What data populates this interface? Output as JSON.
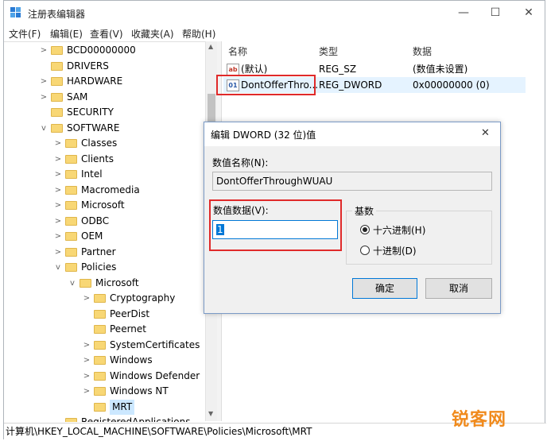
{
  "window": {
    "title": "注册表编辑器",
    "icon": "registry-icon",
    "controls": {
      "minimize": "—",
      "maximize": "☐",
      "close": "✕"
    }
  },
  "menu": [
    "文件(F)",
    "编辑(E)",
    "查看(V)",
    "收藏夹(A)",
    "帮助(H)"
  ],
  "tree": [
    {
      "label": "BCD00000000",
      "expander": ">"
    },
    {
      "label": "DRIVERS",
      "expander": ""
    },
    {
      "label": "HARDWARE",
      "expander": ">"
    },
    {
      "label": "SAM",
      "expander": ">"
    },
    {
      "label": "SECURITY",
      "expander": ""
    },
    {
      "label": "SOFTWARE",
      "expander": "v"
    },
    {
      "label": "Classes",
      "expander": ">"
    },
    {
      "label": "Clients",
      "expander": ">"
    },
    {
      "label": "Intel",
      "expander": ">"
    },
    {
      "label": "Macromedia",
      "expander": ">"
    },
    {
      "label": "Microsoft",
      "expander": ">"
    },
    {
      "label": "ODBC",
      "expander": ">"
    },
    {
      "label": "OEM",
      "expander": ">"
    },
    {
      "label": "Partner",
      "expander": ">"
    },
    {
      "label": "Policies",
      "expander": "v"
    },
    {
      "label": "Microsoft",
      "expander": "v"
    },
    {
      "label": "Cryptography",
      "expander": ">"
    },
    {
      "label": "PeerDist",
      "expander": ""
    },
    {
      "label": "Peernet",
      "expander": ""
    },
    {
      "label": "SystemCertificates",
      "expander": ">"
    },
    {
      "label": "Windows",
      "expander": ">"
    },
    {
      "label": "Windows Defender",
      "expander": ">"
    },
    {
      "label": "Windows NT",
      "expander": ">"
    },
    {
      "label": "MRT",
      "expander": "",
      "selected": true
    },
    {
      "label": "RegisteredApplications",
      "expander": ""
    }
  ],
  "list": {
    "headers": [
      "名称",
      "类型",
      "数据"
    ],
    "rows": [
      {
        "icon": "string-value-icon",
        "icon_text": "ab",
        "name": "(默认)",
        "type": "REG_SZ",
        "data": "(数值未设置)"
      },
      {
        "icon": "binary-value-icon",
        "icon_text": "01",
        "name": "DontOfferThro...",
        "type": "REG_DWORD",
        "data": "0x00000000 (0)",
        "selected": true
      }
    ]
  },
  "status": "计算机\\HKEY_LOCAL_MACHINE\\SOFTWARE\\Policies\\Microsoft\\MRT",
  "dialog": {
    "title": "编辑 DWORD (32 位)值",
    "close": "✕",
    "name_label": "数值名称(N):",
    "name_value": "DontOfferThroughWUAU",
    "data_label": "数值数据(V):",
    "data_value": "1",
    "base_label": "基数",
    "base_options": [
      {
        "label": "十六进制(H)",
        "checked": true
      },
      {
        "label": "十进制(D)",
        "checked": false
      }
    ],
    "ok": "确定",
    "cancel": "取消"
  },
  "watermark": "锐客网",
  "colors": {
    "highlight": "#e5f3ff",
    "selected_tree": "#cce8ff",
    "annotation": "#e02a2a",
    "watermark": "#f08a1c",
    "folder": "#f8d775"
  }
}
